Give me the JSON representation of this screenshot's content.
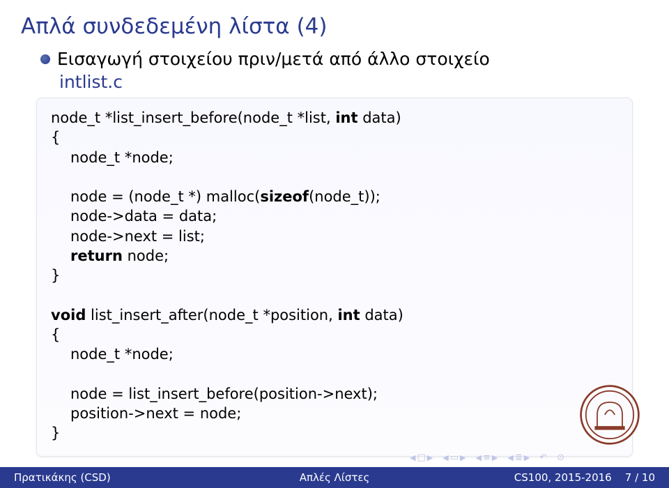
{
  "title": "Απλά συνδεδεμένη λίστα (4)",
  "bullet": "Εισαγωγή στοιχείου πριν/μετά από άλλο στοιχείο",
  "filename": "intlist.c",
  "code": {
    "l1a": "node_t *list_insert_before(node_t *list, ",
    "l1b": "int",
    "l1c": " data)",
    "l2": "{",
    "l3": "node_t *node;",
    "l4a": "node = (node_t *) malloc(",
    "l4b": "sizeof",
    "l4c": "(node_t));",
    "l5": "node->data = data;",
    "l6": "node->next = list;",
    "l7a": "return",
    "l7b": " node;",
    "l8": "}",
    "l9a": "void",
    "l9b": " list_insert_after(node_t *position, ",
    "l9c": "int",
    "l9d": " data)",
    "l10": "{",
    "l11": "node_t *node;",
    "l12": "node = list_insert_before(position->next);",
    "l13": "position->next = node;",
    "l14": "}"
  },
  "footer": {
    "left": "Πρατικάκης (CSD)",
    "center": "Απλές Λίστες",
    "right": "CS100, 2015-2016",
    "page": "7 / 10"
  }
}
